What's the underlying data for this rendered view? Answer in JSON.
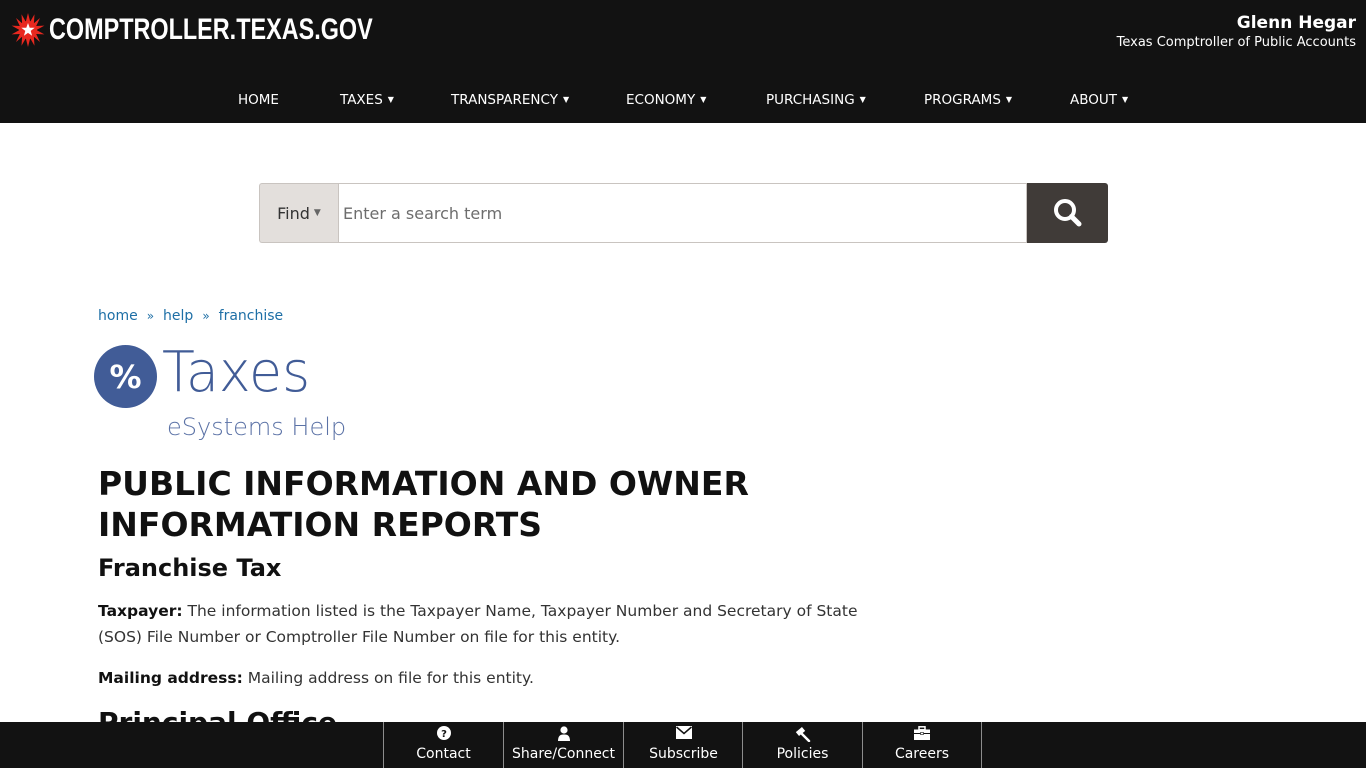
{
  "header": {
    "logo_icon": "texas-star-burst-icon",
    "site_name": "COMPTROLLER.TEXAS.GOV",
    "official_name": "Glenn Hegar",
    "official_title": "Texas Comptroller of Public Accounts"
  },
  "nav": {
    "items": [
      {
        "label": "HOME",
        "has_dropdown": false
      },
      {
        "label": "TAXES",
        "has_dropdown": true
      },
      {
        "label": "TRANSPARENCY",
        "has_dropdown": true
      },
      {
        "label": "ECONOMY",
        "has_dropdown": true
      },
      {
        "label": "PURCHASING",
        "has_dropdown": true
      },
      {
        "label": "PROGRAMS",
        "has_dropdown": true
      },
      {
        "label": "ABOUT",
        "has_dropdown": true
      }
    ],
    "dropdown_glyph": "▼"
  },
  "search": {
    "find_label": "Find",
    "find_caret": "▼",
    "placeholder": "Enter a search term",
    "value": "",
    "button_icon": "search-icon"
  },
  "breadcrumb": {
    "items": [
      "home",
      "help",
      "franchise"
    ],
    "separator": "»"
  },
  "section_brand": {
    "badge_symbol": "%",
    "title": "Taxes",
    "subtitle": "eSystems Help"
  },
  "content": {
    "title": "PUBLIC INFORMATION AND OWNER INFORMATION REPORTS",
    "subtitle": "Franchise Tax",
    "paragraphs": [
      {
        "label": "Taxpayer:",
        "text": " The information listed is the Taxpayer Name, Taxpayer Number and Secretary of State (SOS) File Number or Comptroller File Number on file for this entity."
      },
      {
        "label": "Mailing address:",
        "text": " Mailing address on file for this entity."
      }
    ],
    "next_heading": "Principal Office"
  },
  "footer": {
    "items": [
      {
        "label": "Contact",
        "icon": "question-circle-icon"
      },
      {
        "label": "Share/Connect",
        "icon": "user-icon"
      },
      {
        "label": "Subscribe",
        "icon": "envelope-icon"
      },
      {
        "label": "Policies",
        "icon": "gavel-icon"
      },
      {
        "label": "Careers",
        "icon": "briefcase-icon"
      }
    ]
  },
  "colors": {
    "header_bg": "#121212",
    "brand_blue": "#415c97",
    "link_blue": "#1e6fa6",
    "search_button_bg": "#403b38",
    "find_bg": "#e3dfdc",
    "star_red": "#e8281f"
  }
}
